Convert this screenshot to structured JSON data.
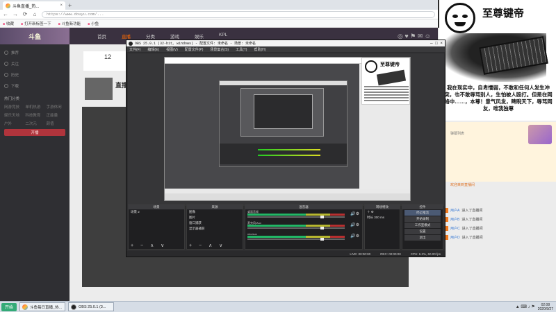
{
  "browser": {
    "tab_title": "斗鱼直播_热...",
    "close_glyph": "×",
    "new_tab_glyph": "+",
    "url": "https://www.douyu.com/...",
    "nav": [
      "←",
      "→",
      "⟳",
      "⌂"
    ],
    "bookmarks": [
      "收藏",
      "打开新标签一下",
      "斗鱼新功能",
      "小鱼"
    ]
  },
  "site": {
    "logo": "斗鱼",
    "nav": [
      "首页",
      "直播",
      "分类",
      "游戏",
      "娱乐",
      "KPL"
    ],
    "active_nav": "直播",
    "header_icons": "◎ ♥ ⚑ ✉ ☺"
  },
  "sidebar": {
    "items": [
      "推荐",
      "关注",
      "历史",
      "下载"
    ],
    "section_label": "热门分类",
    "grid": [
      "网游竞技",
      "单机热游",
      "手游休闲",
      "娱乐天地",
      "科技教育",
      "正能量",
      "户外",
      "二次元",
      "颜值"
    ],
    "button": "开播"
  },
  "room": {
    "count": "12",
    "title": "直播间"
  },
  "chat": {
    "text": "弹幕列表",
    "orange": "欢迎来到直播间",
    "rows": [
      {
        "user": "用户A",
        "msg": "进入了直播间"
      },
      {
        "user": "用户B",
        "msg": "进入了直播间"
      },
      {
        "user": "用户C",
        "msg": "进入了直播间"
      },
      {
        "user": "用户D",
        "msg": "进入了直播间"
      }
    ]
  },
  "meme": {
    "title": "至尊键帝",
    "caption": "我在现实中，自卑懦弱，不敢和任何人发生冲突，也不敢辱骂别人，生怕被人殴打。但是在网络中……，本尊！意气风发，睥睨天下，辱骂网友，唯我独尊",
    "inner_title": "至尊键帝"
  },
  "obs": {
    "title": "OBS 25.0.1 (32-bit, windows) - 配置文件: 未命名 - 场景: 未命名",
    "menu": [
      "文件(F)",
      "编辑(E)",
      "视图(V)",
      "配置文件(P)",
      "场景集合(S)",
      "工具(T)",
      "帮助(H)"
    ],
    "window_buttons": "─ □ ×",
    "docks": {
      "scenes": {
        "header": "场景",
        "items": [
          "场景 2"
        ]
      },
      "sources": {
        "header": "来源",
        "items": [
          "图像",
          "图片",
          "窗口捕获",
          "显示器捕获"
        ]
      },
      "mixer": {
        "header": "混音器",
        "rows": [
          "桌面音频",
          "麦克风/Aux",
          "mic/aux"
        ]
      },
      "transitions": {
        "header": "转场特效",
        "duration_label": "时长",
        "duration": "300 ms"
      },
      "controls": {
        "header": "控件",
        "buttons": [
          "停止推流",
          "开始录制",
          "工作室模式",
          "设置",
          "退出"
        ]
      }
    },
    "dock_footer": "+ − ∧ ∨",
    "status": [
      "LIVE: 00:00:00",
      "REC: 00:00:00",
      "CPU: 6.2%, 60.00 fps"
    ]
  },
  "taskbar": {
    "start": "开始",
    "tasks": [
      "斗鱼每日直播_热...",
      "OBS 25.0.1 (3..."
    ],
    "tray_icons": "▲ ⌨ ♪ ⚑",
    "time": "02:08",
    "date": "2020/9/27"
  }
}
